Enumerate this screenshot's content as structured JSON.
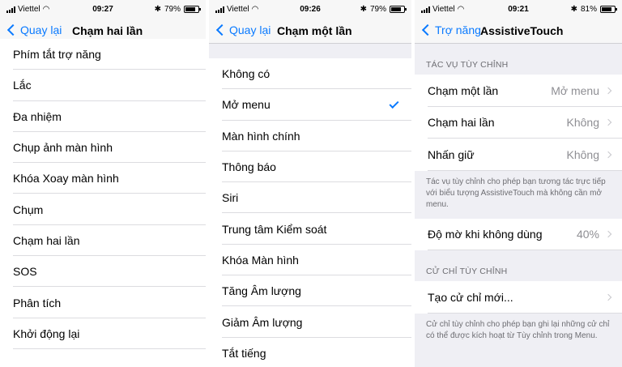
{
  "screens": [
    {
      "status": {
        "carrier": "Viettel",
        "time": "09:27",
        "battery": "79%",
        "battery_level": 0.79
      },
      "nav": {
        "back": "Quay lại",
        "title": "Chạm hai lần"
      },
      "items": [
        "Phím tắt trợ năng",
        "Lắc",
        "Đa nhiệm",
        "Chụp ảnh màn hình",
        "Khóa Xoay màn hình",
        "Chụm",
        "Chạm hai lần",
        "SOS",
        "Phân tích",
        "Khởi động lại"
      ]
    },
    {
      "status": {
        "carrier": "Viettel",
        "time": "09:26",
        "battery": "79%",
        "battery_level": 0.79
      },
      "nav": {
        "back": "Quay lại",
        "title": "Chạm một lần"
      },
      "items": [
        "Không có",
        "Mở menu",
        "Màn hình chính",
        "Thông báo",
        "Siri",
        "Trung tâm Kiểm soát",
        "Khóa Màn hình",
        "Tăng Âm lượng",
        "Giảm Âm lượng",
        "Tắt tiếng"
      ],
      "selected": "Mở menu"
    },
    {
      "status": {
        "carrier": "Viettel",
        "time": "09:21",
        "battery": "81%",
        "battery_level": 0.81
      },
      "nav": {
        "back": "Trợ năng",
        "title": "AssistiveTouch"
      },
      "custom_actions": {
        "header": "TÁC VỤ TÙY CHỈNH",
        "rows": [
          {
            "label": "Chạm một lần",
            "value": "Mở menu"
          },
          {
            "label": "Chạm hai lần",
            "value": "Không"
          },
          {
            "label": "Nhấn giữ",
            "value": "Không"
          }
        ],
        "footer": "Tác vụ tùy chỉnh cho phép bạn tương tác trực tiếp với biểu tượng AssistiveTouch mà không cần mở menu."
      },
      "opacity": {
        "label": "Độ mờ khi không dùng",
        "value": "40%"
      },
      "custom_gestures": {
        "header": "CỬ CHỈ TÙY CHỈNH",
        "rows": [
          {
            "label": "Tạo cử chỉ mới..."
          }
        ],
        "footer": "Cử chỉ tùy chỉnh cho phép bạn ghi lại những cử chỉ có thể được kích hoạt từ Tùy chỉnh trong Menu."
      }
    }
  ]
}
